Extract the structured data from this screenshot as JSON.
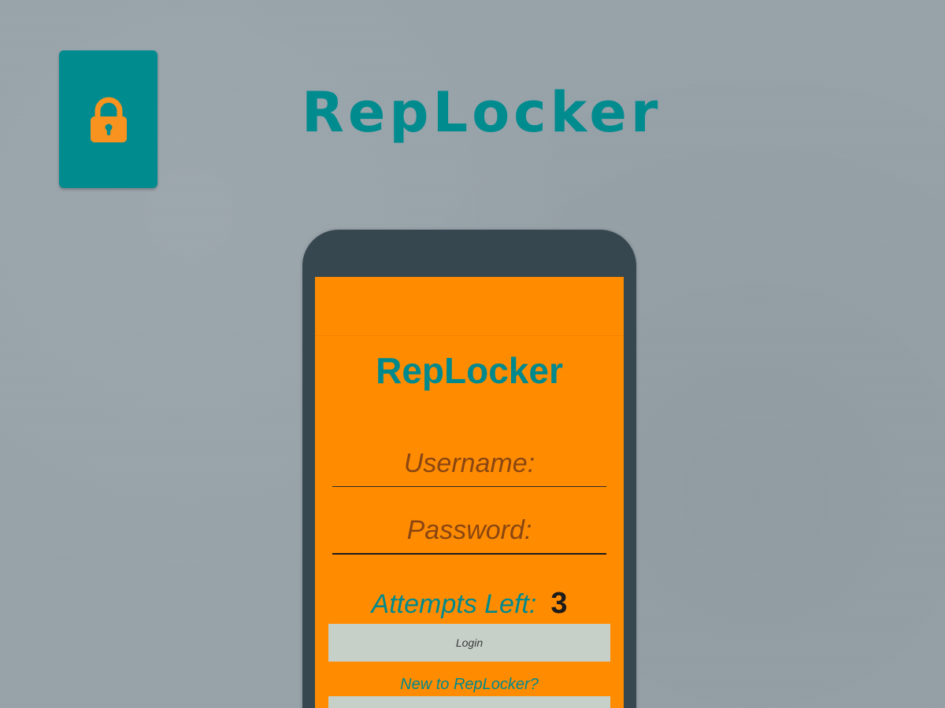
{
  "app": {
    "title": "RepLocker",
    "icon": "padlock-icon",
    "icon_bg_color": "#008b8f",
    "icon_fg_color": "#f7931e"
  },
  "phone": {
    "screen_bg_color": "#ff8c00",
    "app_title": "RepLocker",
    "username_placeholder": "Username:",
    "password_placeholder": "Password:",
    "attempts_label": "Attempts Left:",
    "attempts_count": "3",
    "login_label": "Login",
    "new_user_link": "New to RepLocker?"
  }
}
